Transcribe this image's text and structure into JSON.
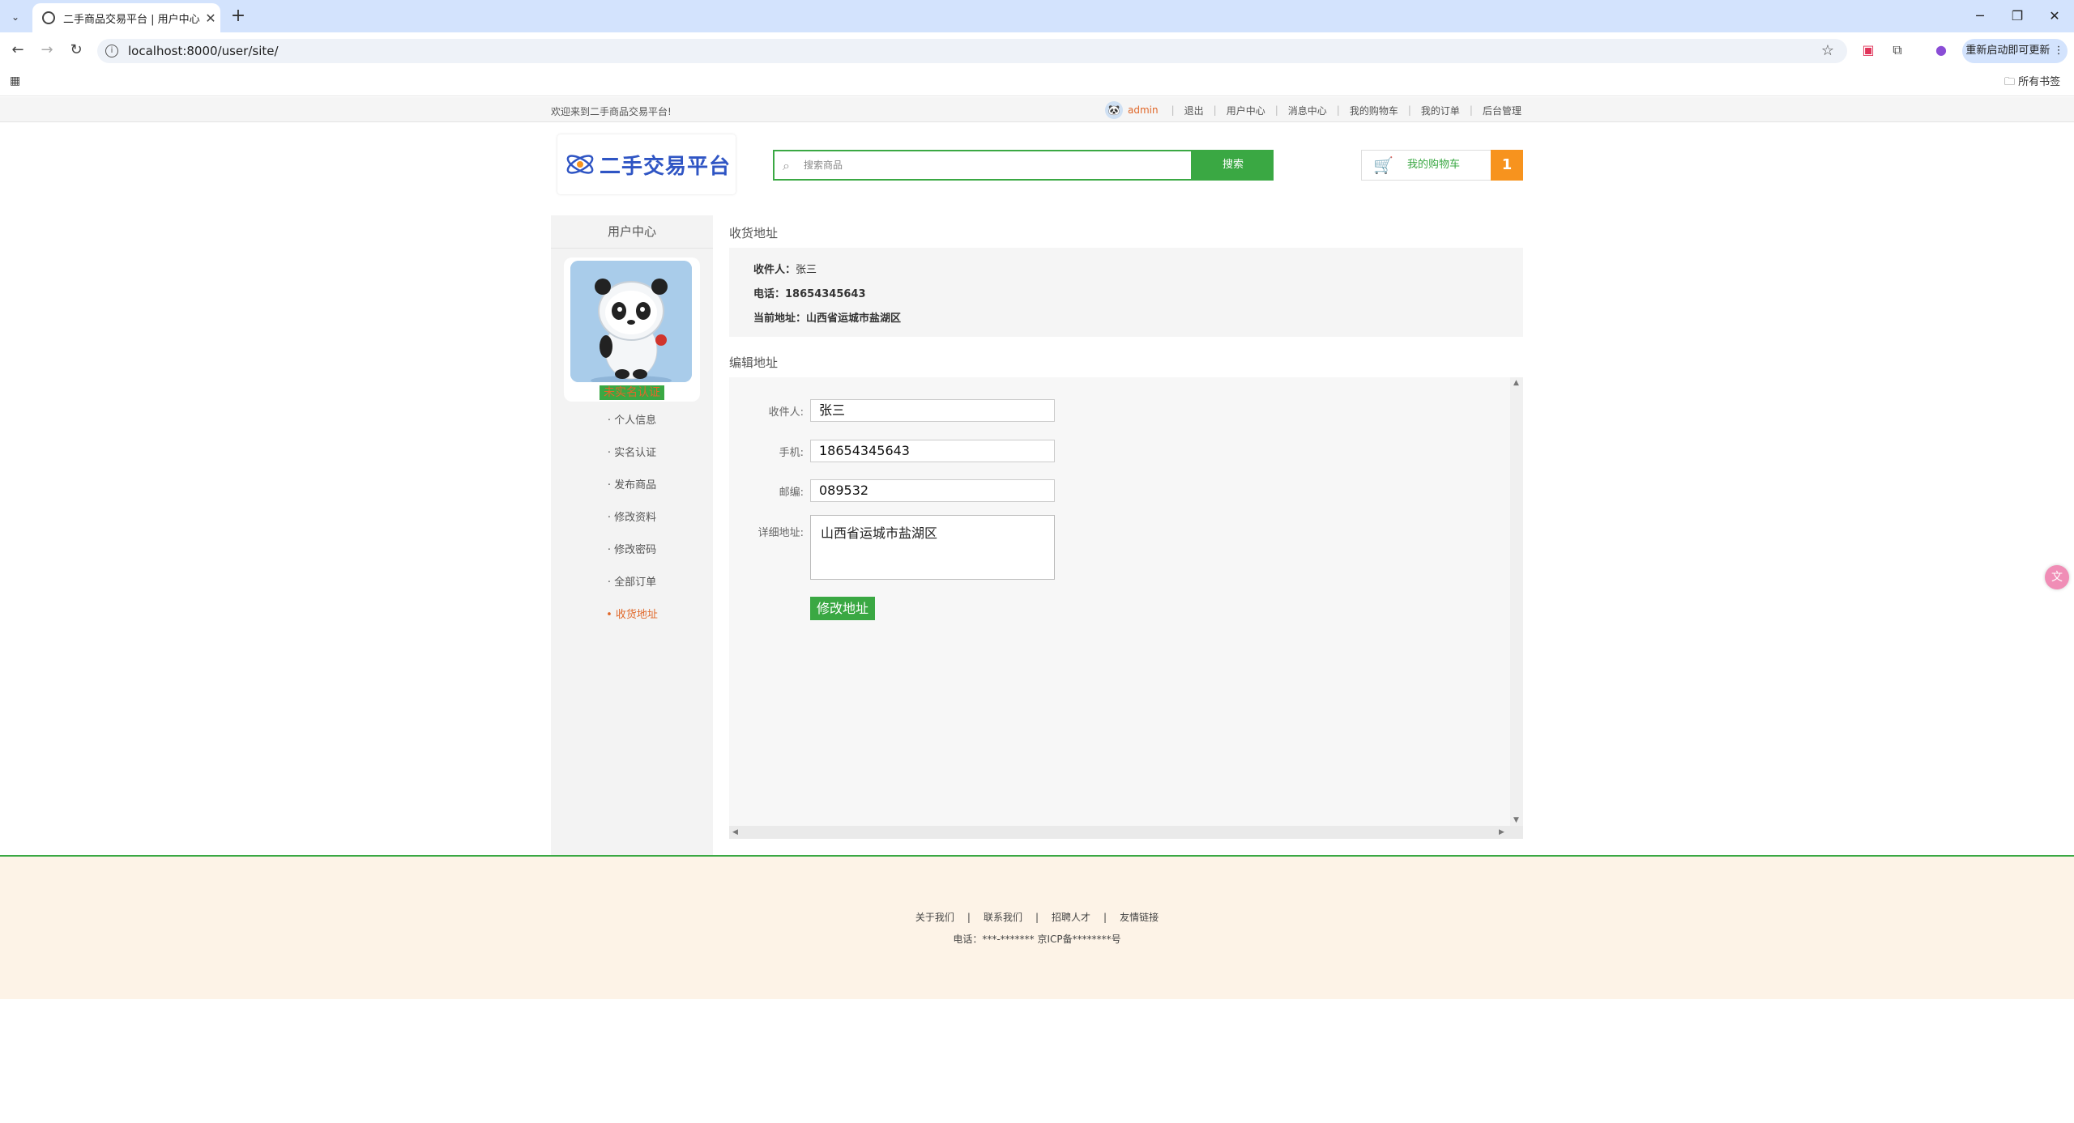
{
  "browser": {
    "tab_title": "二手商品交易平台 | 用户中心",
    "url": "localhost:8000/user/site/",
    "update_label": "重新启动即可更新",
    "all_bookmarks": "所有书签"
  },
  "topbar": {
    "welcome": "欢迎来到二手商品交易平台!",
    "username": "admin",
    "links": [
      "退出",
      "用户中心",
      "消息中心",
      "我的购物车",
      "我的订单",
      "后台管理"
    ]
  },
  "header": {
    "logo_text": "二手交易平台",
    "search_placeholder": "搜索商品",
    "search_button": "搜索",
    "cart_label": "我的购物车",
    "cart_count": "1"
  },
  "sidebar": {
    "title": "用户中心",
    "realname_badge": "未实名认证",
    "items": [
      {
        "label": "· 个人信息"
      },
      {
        "label": "· 实名认证"
      },
      {
        "label": "· 发布商品"
      },
      {
        "label": "· 修改资料"
      },
      {
        "label": "· 修改密码"
      },
      {
        "label": "· 全部订单"
      },
      {
        "label": "• 收货地址"
      }
    ]
  },
  "address": {
    "section_title": "收货地址",
    "receiver_label": "收件人：",
    "receiver": "张三",
    "phone_label": "电话：",
    "phone": "18654345643",
    "current_label": "当前地址：",
    "current": "山西省运城市盐湖区"
  },
  "edit": {
    "section_title": "编辑地址",
    "receiver_label": "收件人:",
    "receiver_value": "张三",
    "phone_label": "手机:",
    "phone_value": "18654345643",
    "zip_label": "邮编:",
    "zip_value": "089532",
    "detail_label": "详细地址:",
    "detail_value": "山西省运城市盐湖区",
    "submit_label": "修改地址"
  },
  "footer": {
    "links": [
      "关于我们",
      "联系我们",
      "招聘人才",
      "友情链接"
    ],
    "copyright": "电话：***-******* 京ICP备********号"
  }
}
